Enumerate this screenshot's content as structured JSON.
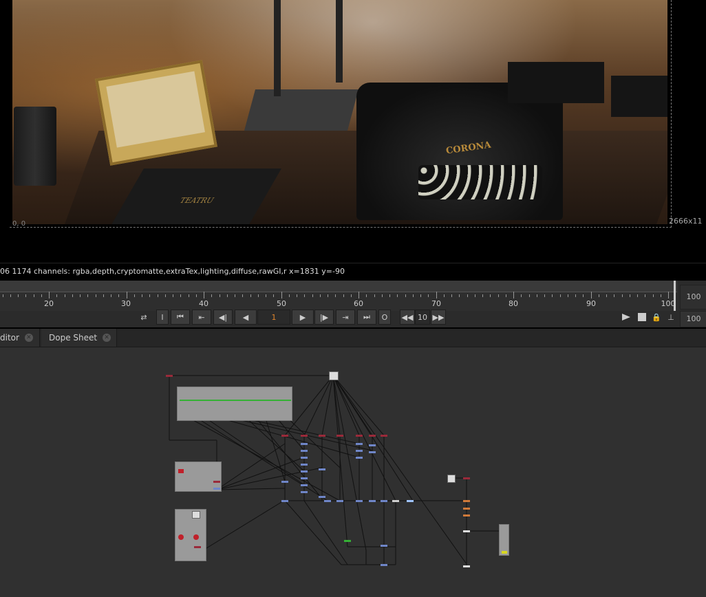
{
  "viewer": {
    "origin_label": "0, 0",
    "size_label": "2666x11",
    "info_text": "06 1174 channels: rgba,depth,cryptomatte,extraTex,lighting,diffuse,rawGI,r  x=1831 y=-90",
    "photo": {
      "label_teatru": "TEATRU",
      "label_corona": "CORONA"
    }
  },
  "timeline": {
    "ruler_labels": [
      "20",
      "30",
      "40",
      "50",
      "60",
      "70",
      "80",
      "90",
      "100"
    ],
    "end_frame_box": "100",
    "playback": {
      "in_label": "I",
      "current_frame": "1",
      "out_label": "O",
      "increment": "10",
      "end_frame": "100"
    }
  },
  "tabs": [
    {
      "label": "ditor"
    },
    {
      "label": "Dope Sheet"
    }
  ],
  "icons": {
    "loop": "loop-icon",
    "first": "skip-to-first-icon",
    "prev_key": "prev-keyframe-icon",
    "prev_frame": "step-back-icon",
    "play_back": "play-backward-icon",
    "play_fwd": "play-forward-icon",
    "next_frame": "step-forward-icon",
    "next_key": "next-keyframe-icon",
    "last": "skip-to-last-icon",
    "jump_back": "jump-back-icon",
    "jump_fwd": "jump-forward-icon",
    "flipbook": "flipbook-icon",
    "record": "record-icon",
    "lock": "lock-icon",
    "range": "range-icon"
  },
  "colors": {
    "accent_frame": "#e0852d",
    "node_red": "#9a2a3a",
    "node_blue": "#6f86c8",
    "node_green": "#35b035",
    "node_orange": "#d07a3a",
    "node_yellow": "#d8d820"
  }
}
